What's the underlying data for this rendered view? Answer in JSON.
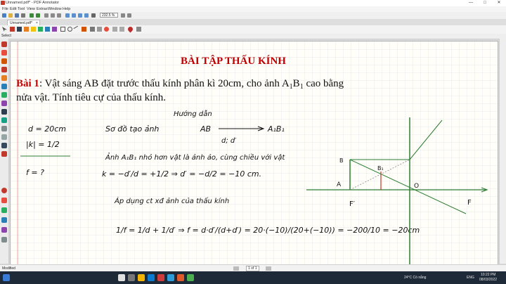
{
  "window": {
    "title": "Unnamed.pdf* - PDF Annotator",
    "minimize": "—",
    "maximize": "□",
    "close": "✕"
  },
  "menu": [
    "File",
    "Edit",
    "Tool",
    "View",
    "Extras",
    "Window",
    "Help"
  ],
  "toolbar": {
    "zoom": "232.5 %"
  },
  "tab": {
    "label": "Unnamed.pdf*",
    "close": "×"
  },
  "subbar": {
    "label": "Select"
  },
  "document": {
    "heading": "BÀI TẬP THẤU KÍNH",
    "problem_label": "Bài 1",
    "problem_line1_a": ": Vật sáng AB đặt trước thấu kính phân kì 20cm, cho ảnh A",
    "sub1": "1",
    "problem_line1_b": "B",
    "sub2": "1",
    "problem_line1_c": " cao bằng",
    "problem_line2": "nửa vật. Tính tiêu cự của thấu kính.",
    "hw": {
      "guide": "Hướng dẫn",
      "given_d": "d = 20cm",
      "given_k": "|k| = 1/2",
      "find_f": "f = ?",
      "scheme": "Sơ đồ tạo ảnh",
      "ab": "AB",
      "a1b1": "A₁B₁",
      "d_dprime": "d;  d′",
      "statement": "Ảnh A₁B₁ nhỏ hơn vật là ảnh ảo, cùng chiều với vật",
      "step_k": "k = −d′/d = +1/2  ⇒  d′ = −d/2 = −10 cm.",
      "apply": "Áp dụng ct xđ ảnh của thấu kính",
      "formula": "1/f = 1/d + 1/d′  ⇒  f = d·d′/(d+d′) = 20·(−10)/(20+(−10)) = −200/10 = −20cm",
      "diagram": {
        "B": "B",
        "A": "A",
        "B1": "B₁",
        "O": "O",
        "F": "F",
        "Fp": "F′"
      }
    }
  },
  "status": {
    "left": "Modified",
    "page": "1 of 1"
  },
  "tray": {
    "weather": "24°C  Có nắng",
    "lang": "ENG",
    "time": "10:22 PM",
    "date": "08/03/2022"
  },
  "colors": {
    "taskbar": "#1f2a38",
    "diagram_line": "#2e7d32",
    "ink": "#111111"
  }
}
